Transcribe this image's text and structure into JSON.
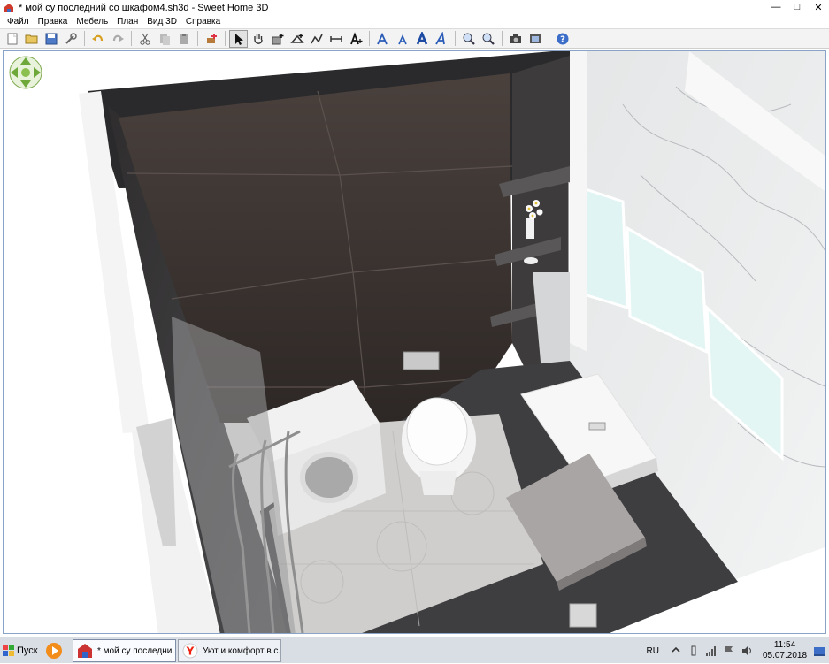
{
  "window": {
    "title": "* мой су последний со шкафом4.sh3d - Sweet Home 3D",
    "minimize": "—",
    "maximize": "□",
    "close": "✕"
  },
  "menu": {
    "items": [
      {
        "label": "Файл"
      },
      {
        "label": "Правка"
      },
      {
        "label": "Мебель"
      },
      {
        "label": "План"
      },
      {
        "label": "Вид 3D"
      },
      {
        "label": "Справка"
      }
    ]
  },
  "toolbar": {
    "icons": [
      "new-home-icon",
      "open-icon",
      "save-icon",
      "preferences-icon",
      "undo-icon",
      "redo-icon",
      "cut-icon",
      "copy-icon",
      "paste-icon",
      "add-furniture-icon",
      "select-icon",
      "pan-icon",
      "create-walls-icon",
      "create-rooms-icon",
      "create-polylines-icon",
      "create-dimensions-icon",
      "create-labels-icon",
      "increase-text-size-icon",
      "decrease-text-size-icon",
      "bold-text-icon",
      "italic-text-icon",
      "zoom-in-icon",
      "zoom-out-icon",
      "create-photo-icon",
      "create-video-icon",
      "help-icon"
    ]
  },
  "taskbar": {
    "start_label": "Пуск",
    "tasks": [
      {
        "label": "* мой су последни..."
      },
      {
        "label": "Уют и комфорт в с..."
      }
    ],
    "language": "RU",
    "time": "11:54",
    "date": "05.07.2018"
  },
  "colors": {
    "tile_dark": "#3a3330",
    "floor_light": "#cfcecc",
    "floor_dark": "#3e3e40",
    "marble": "#e9eaea",
    "view_border": "#8aa3c9"
  }
}
